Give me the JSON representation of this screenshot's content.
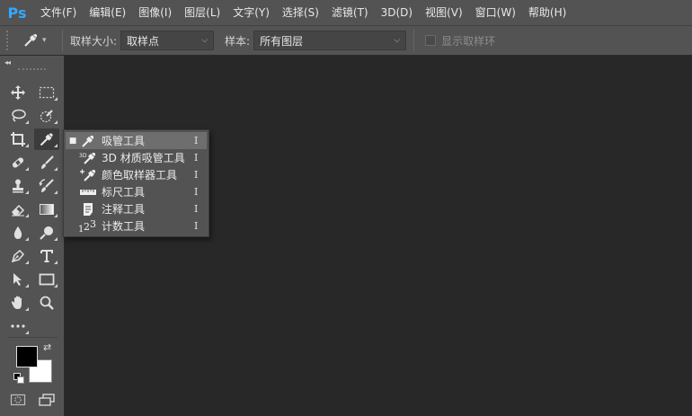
{
  "app": {
    "logo": "Ps"
  },
  "menubar": {
    "items": [
      "文件(F)",
      "编辑(E)",
      "图像(I)",
      "图层(L)",
      "文字(Y)",
      "选择(S)",
      "滤镜(T)",
      "3D(D)",
      "视图(V)",
      "窗口(W)",
      "帮助(H)"
    ]
  },
  "options": {
    "tool_icon": "eyedropper-icon",
    "sample_size_label": "取样大小:",
    "sample_size_value": "取样点",
    "sample_label": "样本:",
    "sample_value": "所有图层",
    "show_ring_label": "显示取样环",
    "show_ring_checked": false
  },
  "toolbar": {
    "collapse_label": "◂◂",
    "tools": [
      "move-icon",
      "marquee-icon",
      "lasso-icon",
      "quick-select-icon",
      "crop-icon",
      "eyedropper-icon",
      "healing-brush-icon",
      "brush-icon",
      "clone-stamp-icon",
      "history-brush-icon",
      "eraser-icon",
      "gradient-icon",
      "blur-icon",
      "dodge-icon",
      "pen-icon",
      "type-icon",
      "path-select-icon",
      "rectangle-icon",
      "hand-icon",
      "zoom-icon",
      "more-tools-icon"
    ],
    "foreground_color": "#000000",
    "background_color": "#ffffff"
  },
  "flyout": {
    "items": [
      {
        "label": "吸管工具",
        "shortcut": "I",
        "icon": "eyedropper-icon",
        "selected": true
      },
      {
        "label": "3D 材质吸管工具",
        "shortcut": "I",
        "icon": "3d-material-eyedropper-icon",
        "selected": false
      },
      {
        "label": "颜色取样器工具",
        "shortcut": "I",
        "icon": "color-sampler-icon",
        "selected": false
      },
      {
        "label": "标尺工具",
        "shortcut": "I",
        "icon": "ruler-icon",
        "selected": false
      },
      {
        "label": "注释工具",
        "shortcut": "I",
        "icon": "note-icon",
        "selected": false
      },
      {
        "label": "计数工具",
        "shortcut": "I",
        "icon": "count-icon",
        "selected": false
      }
    ]
  },
  "colors": {
    "workspace": "#282828",
    "panel": "#535353",
    "ps_blue": "#31a8ff"
  }
}
